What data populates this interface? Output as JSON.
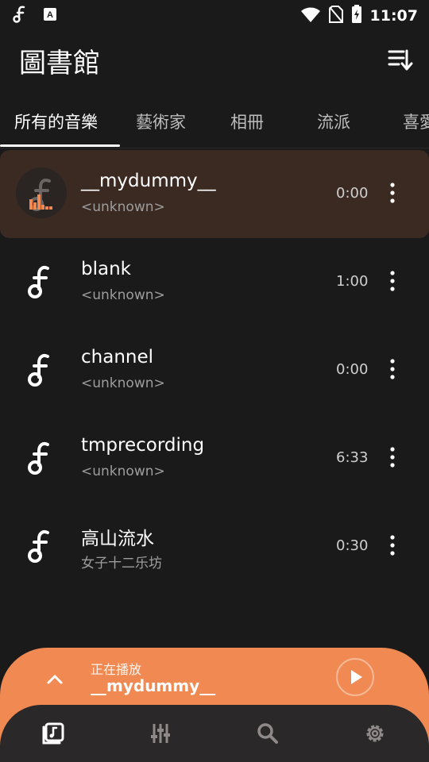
{
  "status_bar": {
    "time": "11:07",
    "icons": [
      "music-note-icon",
      "font-a-icon",
      "wifi-icon",
      "no-sim-icon",
      "battery-charging-icon"
    ]
  },
  "header": {
    "title": "圖書館",
    "sort_icon": "sort-icon"
  },
  "tabs": [
    {
      "label": "所有的音樂",
      "active": true
    },
    {
      "label": "藝術家",
      "active": false
    },
    {
      "label": "相冊",
      "active": false
    },
    {
      "label": "流派",
      "active": false
    },
    {
      "label": "喜愛",
      "active": false
    }
  ],
  "songs": [
    {
      "title": "__mydummy__",
      "artist": "<unknown>",
      "duration": "0:00",
      "playing": true
    },
    {
      "title": "blank",
      "artist": "<unknown>",
      "duration": "1:00",
      "playing": false
    },
    {
      "title": "channel",
      "artist": "<unknown>",
      "duration": "0:00",
      "playing": false
    },
    {
      "title": "tmprecording",
      "artist": "<unknown>",
      "duration": "6:33",
      "playing": false
    },
    {
      "title": "高山流水",
      "artist": "女子十二乐坊",
      "duration": "0:30",
      "playing": false
    }
  ],
  "now_playing": {
    "label": "正在播放",
    "title": "__mydummy__"
  },
  "bottom_nav": [
    {
      "icon": "library-icon",
      "active": true
    },
    {
      "icon": "equalizer-icon",
      "active": false
    },
    {
      "icon": "search-icon",
      "active": false
    },
    {
      "icon": "settings-icon",
      "active": false
    }
  ],
  "colors": {
    "accent": "#f08a52",
    "background": "#1b1a1a",
    "playing_row": "#3a2a22",
    "nav_bg": "#2a2828"
  }
}
